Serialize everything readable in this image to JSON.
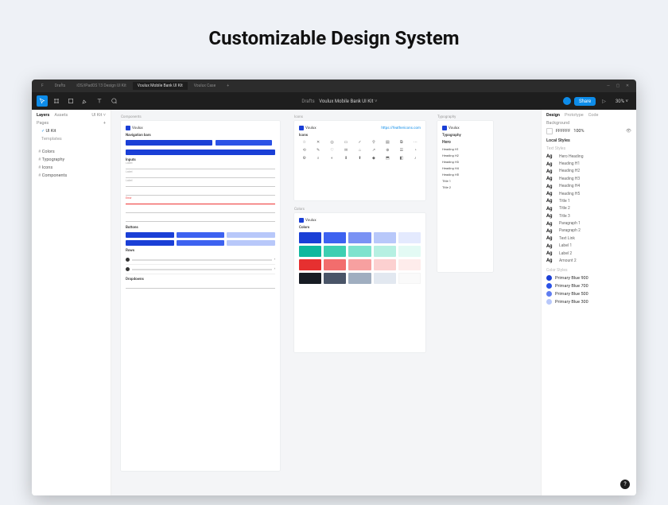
{
  "page_title": "Customizable Design System",
  "titlebar": {
    "tabs": [
      "Drafts",
      "iOS/iPadOS 13 Design UI Kit",
      "Voulux Mobile Bank UI Kit",
      "Voulux Case"
    ],
    "active": 2
  },
  "toolbar": {
    "breadcrumb_prefix": "Drafts",
    "file_name": "Voulux Mobile Bank UI Kit",
    "share_label": "Share",
    "zoom": "30%"
  },
  "left": {
    "tabs": [
      "Layers",
      "Assets"
    ],
    "scope": "UI Kit",
    "pages_label": "Pages",
    "pages": [
      "UI Kit",
      "Templates"
    ],
    "current_page": 0,
    "layers": [
      "Colors",
      "Typography",
      "Icons",
      "Components"
    ]
  },
  "canvas": {
    "components": {
      "frame_label": "Components",
      "brand": "Voulux",
      "nav_label": "Navigation bars",
      "inputs_label": "Inputs",
      "buttons_label": "Buttons",
      "rows_label": "Rows",
      "dropdowns_label": "Dropdowns"
    },
    "icons": {
      "frame_label": "Icons",
      "brand": "Voulux",
      "heading": "Icons",
      "link": "https://feathericons.com",
      "glyphs": [
        "☆",
        "✕",
        "◎",
        "▭",
        "✓",
        "⚲",
        "▤",
        "⧉",
        "⋯",
        "⟲",
        "✎",
        "♡",
        "✉",
        "⌂",
        "↗",
        "⊕",
        "☰",
        "◔",
        "⚙",
        "⌕",
        "◐",
        "⬇",
        "⬆",
        "◆",
        "⬒",
        "◧",
        "♪"
      ]
    },
    "colors": {
      "frame_label": "Colors",
      "brand": "Voulux",
      "heading": "Colors"
    },
    "typography": {
      "frame_label": "Typography",
      "brand": "Voulux",
      "heading": "Typography",
      "items": [
        "Hero",
        "Heading H1",
        "Heading H2",
        "Heading H3",
        "Heading H4",
        "Heading H5",
        "Title 1",
        "Title 2"
      ]
    }
  },
  "right": {
    "tabs": [
      "Design",
      "Prototype",
      "Code"
    ],
    "background_label": "Background",
    "background_hex": "FFFFFF",
    "background_opacity": "100%",
    "local_styles": "Local Styles",
    "text_styles_label": "Text Styles",
    "text_styles": [
      "Hero Heading",
      "Heading H1",
      "Heading H2",
      "Heading H3",
      "Heading H4",
      "Heading H5",
      "Title 1",
      "Title 2",
      "Title 3",
      "Paragraph 1",
      "Paragraph 2",
      "Text Link",
      "Label 1",
      "Label 2",
      "Amount 2"
    ],
    "color_styles_label": "Color Styles",
    "color_styles": [
      {
        "name": "Primary Blue 900",
        "hex": "#1a3fd6"
      },
      {
        "name": "Primary Blue 700",
        "hex": "#2b52e6"
      },
      {
        "name": "Primary Blue 500",
        "hex": "#5f7df0"
      },
      {
        "name": "Primary Blue 300",
        "hex": "#b8c8fa"
      }
    ]
  },
  "help_label": "?"
}
